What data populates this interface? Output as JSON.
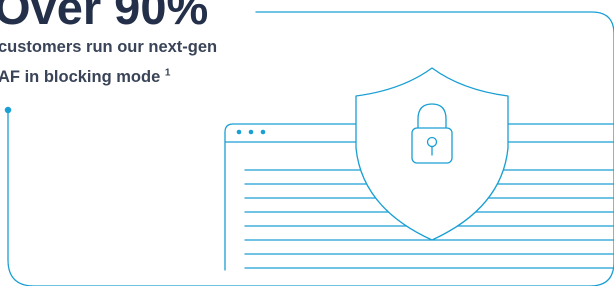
{
  "headline": "Over 90%",
  "subtext": {
    "line1": "customers run our next-gen",
    "line2": "AF in blocking mode",
    "footnote": "1"
  },
  "colors": {
    "headline": "#24304a",
    "body_text": "#3a4458",
    "line_art": "#1a9fd4"
  },
  "icons": {
    "illustration": "browser-window-with-shield-lock"
  }
}
